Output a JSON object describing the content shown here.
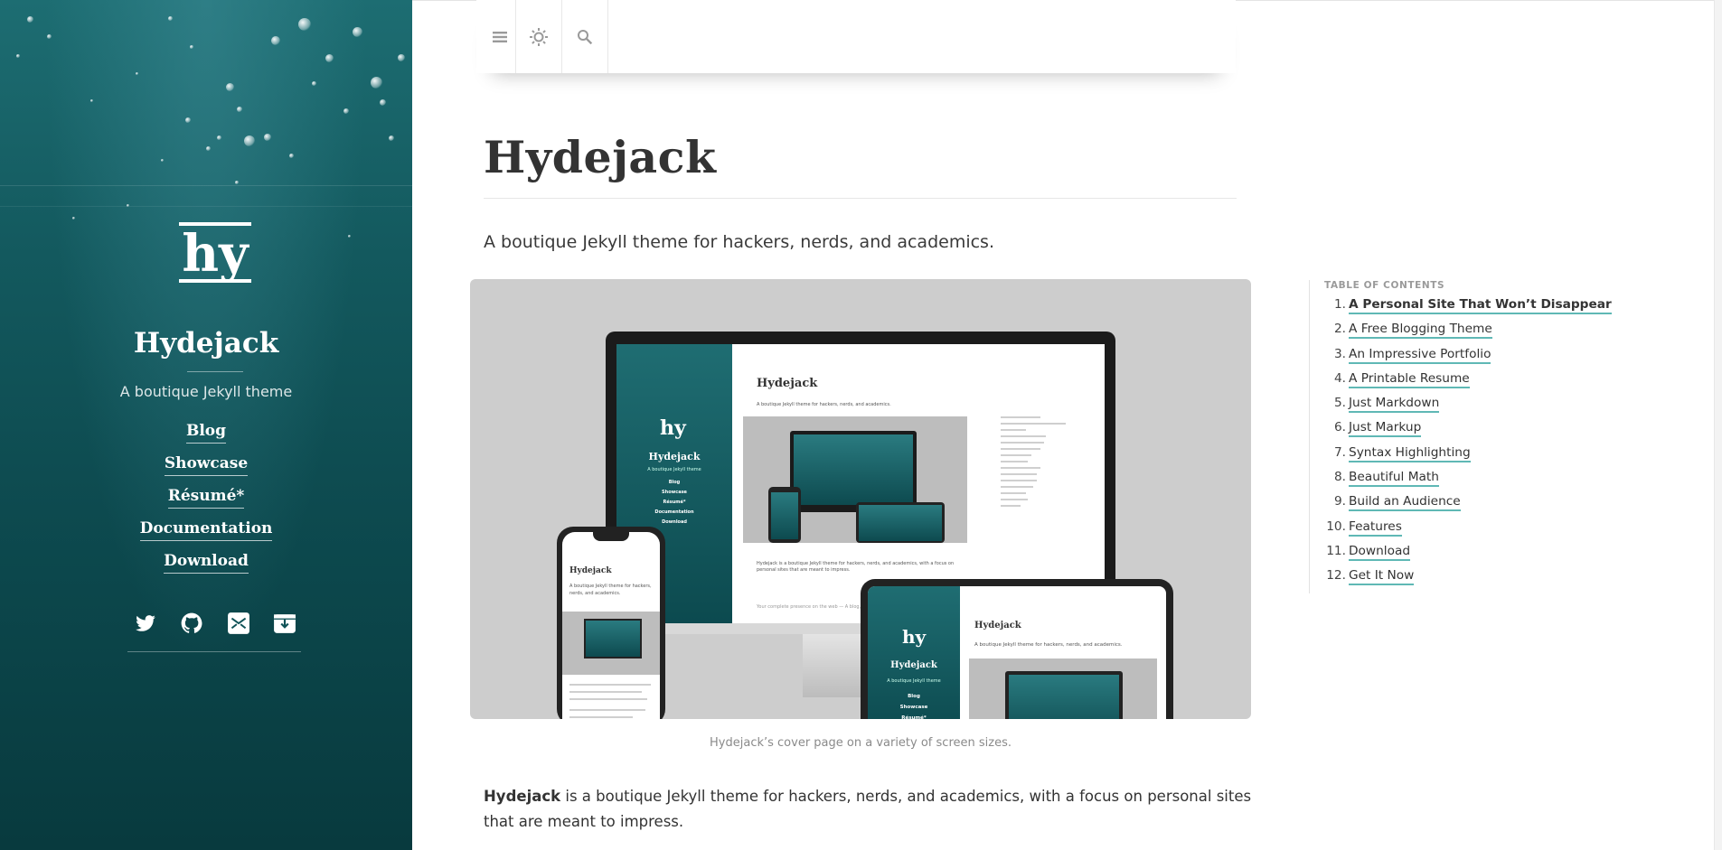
{
  "sidebar": {
    "logo_alt": "hy",
    "title": "Hydejack",
    "tagline": "A boutique Jekyll theme",
    "nav": [
      "Blog",
      "Showcase",
      "Résumé*",
      "Documentation",
      "Download"
    ],
    "social_icons": [
      "twitter-icon",
      "github-icon",
      "email-icon",
      "rss-icon"
    ]
  },
  "navbar": {
    "icons": [
      "menu-icon",
      "theme-toggle-icon",
      "search-icon"
    ]
  },
  "main": {
    "title": "Hydejack",
    "lead": "A boutique Jekyll theme for hackers, nerds, and academics.",
    "hero_caption": "Hydejack’s cover page on a variety of screen sizes.",
    "body_bold": "Hydejack",
    "body_rest": " is a boutique Jekyll theme for hackers, nerds, and academics, with a focus on personal sites that are meant to impress."
  },
  "toc": {
    "heading": "Table of Contents",
    "items": [
      {
        "num": "1.",
        "label": "A Personal Site That Won’t Disappear"
      },
      {
        "num": "2.",
        "label": "A Free Blogging Theme"
      },
      {
        "num": "3.",
        "label": "An Impressive Portfolio"
      },
      {
        "num": "4.",
        "label": "A Printable Resume"
      },
      {
        "num": "5.",
        "label": "Just Markdown"
      },
      {
        "num": "6.",
        "label": "Just Markup"
      },
      {
        "num": "7.",
        "label": "Syntax Highlighting"
      },
      {
        "num": "8.",
        "label": "Beautiful Math"
      },
      {
        "num": "9.",
        "label": "Build an Audience"
      },
      {
        "num": "10.",
        "label": "Features"
      },
      {
        "num": "11.",
        "label": "Download"
      },
      {
        "num": "12.",
        "label": "Get It Now"
      }
    ]
  },
  "mockup": {
    "site_title": "Hydejack",
    "tagline_short": "A boutique Jekyll theme",
    "lead": "A boutique Jekyll theme for hackers, nerds, and academics.",
    "nav": [
      "Blog",
      "Showcase",
      "Résumé*",
      "Documentation",
      "Download"
    ],
    "desktop_body": "Hydejack is a boutique Jekyll theme for hackers, nerds, and academics, with a focus on personal sites that are meant to impress.",
    "quote": "Your complete presence on the web — A blog, portfolio, and resume.",
    "phone_lead": "A boutique Jekyll theme for hackers, nerds, and academics."
  },
  "colors": {
    "accent": "#5fb8b5",
    "sidebar_top": "#1d6d72",
    "sidebar_bottom": "#083a3e"
  }
}
